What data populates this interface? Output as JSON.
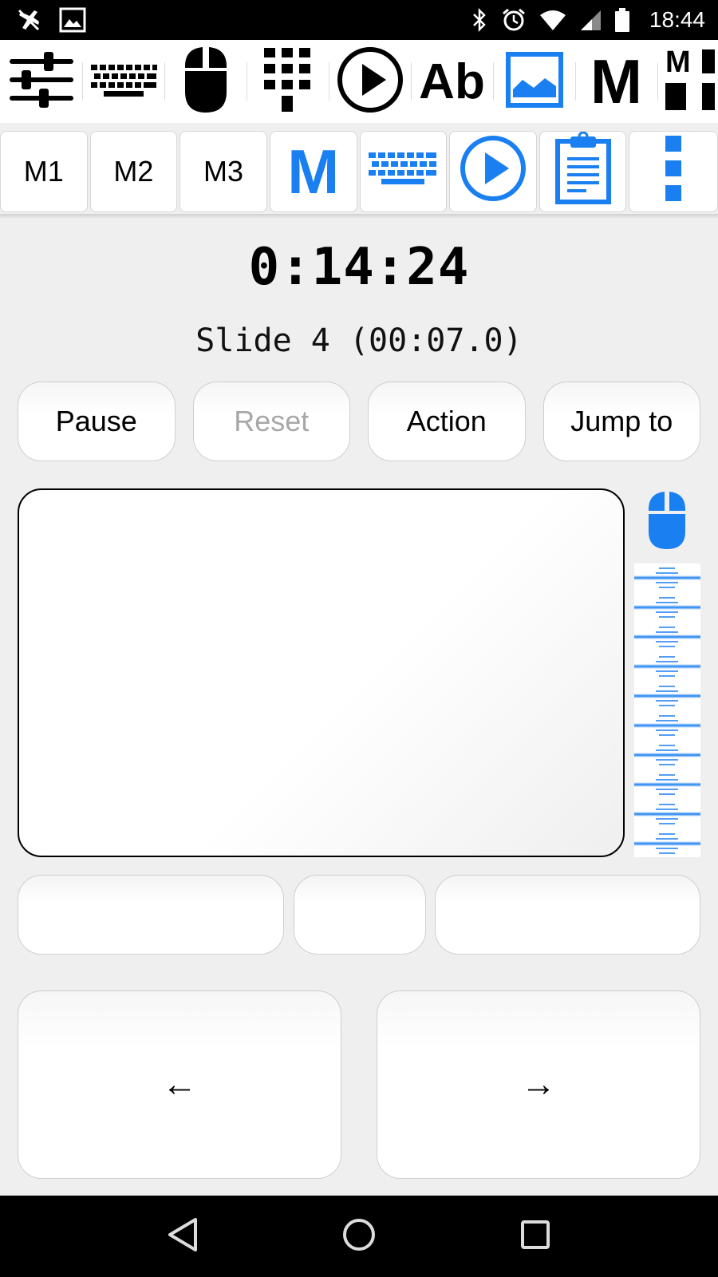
{
  "status_bar": {
    "time": "18:44",
    "left_icons": [
      "no-sim-airplane-icon",
      "image-icon"
    ],
    "right_icons": [
      "bluetooth-icon",
      "alarm-icon",
      "wifi-icon",
      "cellular-signal-icon",
      "battery-icon"
    ]
  },
  "toolbar_top": {
    "items": [
      {
        "icon": "sliders-icon"
      },
      {
        "icon": "keyboard-icon"
      },
      {
        "icon": "mouse-icon"
      },
      {
        "icon": "numpad-icon"
      },
      {
        "icon": "play-circle-icon"
      },
      {
        "icon": "text-ab-icon",
        "label": "Ab"
      },
      {
        "icon": "image-icon",
        "selected": true
      },
      {
        "icon": "macro-m-icon",
        "label": "M"
      },
      {
        "icon": "macro-grid-icon",
        "label": "M"
      }
    ]
  },
  "toolbar_second": {
    "buttons": [
      {
        "label": "M1"
      },
      {
        "label": "M2"
      },
      {
        "label": "M3"
      },
      {
        "icon": "macro-m-blue-icon",
        "label": "M"
      },
      {
        "icon": "keyboard-blue-icon"
      },
      {
        "icon": "play-circle-blue-icon"
      },
      {
        "icon": "clipboard-blue-icon"
      },
      {
        "icon": "more-vertical-icon"
      }
    ]
  },
  "timer": "0:14:24",
  "slide_info": "Slide 4 (00:07.0)",
  "actions": {
    "pause": "Pause",
    "reset": "Reset",
    "action": "Action",
    "jump_to": "Jump to"
  },
  "arrows": {
    "left": "←",
    "right": "→"
  },
  "colors": {
    "accent": "#1a7ff0",
    "background": "#efefef"
  },
  "nav_bar": {
    "icons": [
      "back-triangle-icon",
      "home-circle-icon",
      "recents-square-icon"
    ]
  }
}
